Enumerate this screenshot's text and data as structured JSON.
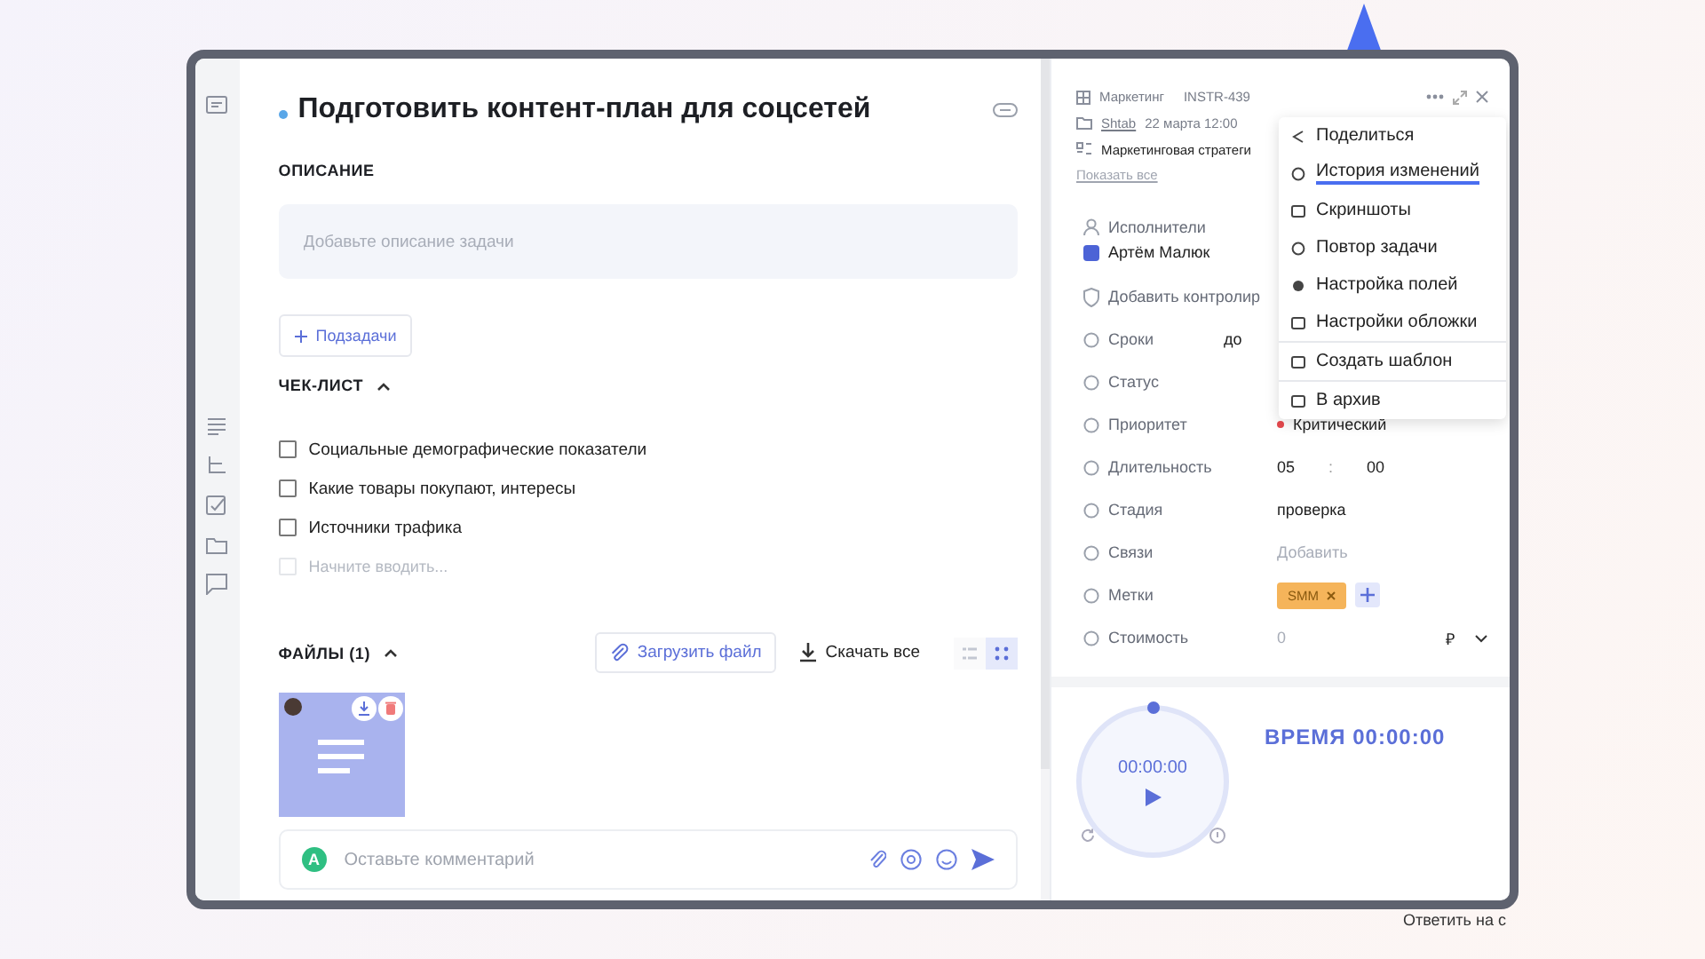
{
  "task": {
    "title": "Подготовить контент-план для соцсетей",
    "description_heading": "ОПИСАНИЕ",
    "description": {
      "placeholder": "Добавьте описание задачи"
    },
    "subtasks_button": "Подзадачи",
    "checklist": {
      "title": "ЧЕК-ЛИСТ",
      "expanded": true,
      "items": [
        {
          "label": "Социальные демографические показатели",
          "checked": false
        },
        {
          "label": "Какие товары покупают, интересы",
          "checked": false
        },
        {
          "label": "Источники трафика",
          "checked": false
        }
      ],
      "new_item": {
        "placeholder": "Начните вводить...",
        "checked": false
      }
    },
    "files": {
      "title": "ФАЙЛЫ (1)",
      "expanded": true,
      "upload_button": "Загрузить файл",
      "download_button": "Скачать все",
      "views": [
        {
          "kind": "list",
          "selected": false
        },
        {
          "kind": "grid",
          "selected": true
        }
      ]
    },
    "comment": {
      "avatar": "A",
      "placeholder": "Оставьте комментарий"
    }
  },
  "details": {
    "project": "Маркетинг",
    "task_id": "INSTR-439",
    "space": "Shtab",
    "date": "22 марта 12:00",
    "goal": "Маркетинговая стратеги",
    "show_all": "Показать все",
    "fields": [
      {
        "kind": "assignee",
        "label": "Исполнители",
        "value": "Артём Малюк"
      },
      {
        "kind": "action",
        "label": "Добавить контролир"
      },
      {
        "kind": "deadline",
        "label": "Сроки",
        "value": "до"
      },
      {
        "kind": "text",
        "label": "Статус"
      },
      {
        "kind": "priority",
        "label": "Приоритет",
        "value": "Критический",
        "color": "#e5484d"
      },
      {
        "kind": "duration",
        "label": "Длительность",
        "hours": "05",
        "separator": ":",
        "minutes": "00"
      },
      {
        "kind": "text",
        "label": "Стадия",
        "value": "проверка"
      },
      {
        "kind": "link",
        "label": "Связи",
        "placeholder": "Добавить"
      },
      {
        "kind": "tags",
        "label": "Метки",
        "tags": [
          {
            "label": "SMM",
            "color": "#f5b45a"
          }
        ]
      },
      {
        "kind": "cost",
        "label": "Стоимость",
        "value": "0",
        "currency": "₽"
      }
    ]
  },
  "menu": {
    "groups": [
      [
        {
          "label": "Поделиться",
          "selected": false
        },
        {
          "label": "История изменений",
          "selected": true
        },
        {
          "label": "Скриншоты",
          "selected": false
        },
        {
          "label": "Повтор задачи",
          "selected": false
        },
        {
          "label": "Настройка полей",
          "selected": false
        },
        {
          "label": "Настройки обложки",
          "selected": false
        }
      ],
      [
        {
          "label": "Создать шаблон",
          "selected": false
        }
      ],
      [
        {
          "label": "В архив",
          "selected": false
        }
      ]
    ]
  },
  "timer": {
    "clock": "00:00:00",
    "title": "ВРЕМЯ 00:00:00"
  },
  "background_page": {
    "text": "Ответить на с"
  }
}
